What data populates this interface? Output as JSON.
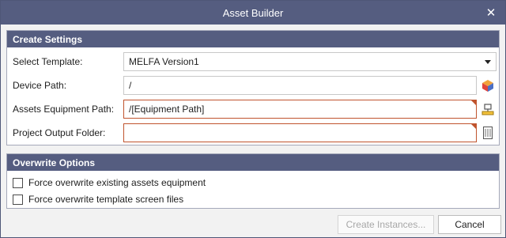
{
  "window": {
    "title": "Asset Builder",
    "close_glyph": "✕"
  },
  "create_settings": {
    "header": "Create Settings",
    "select_template": {
      "label": "Select Template:",
      "value": "MELFA Version1"
    },
    "device_path": {
      "label": "Device Path:",
      "value": "/",
      "icon": "device-picker-icon"
    },
    "assets_equipment_path": {
      "label": "Assets Equipment Path:",
      "value": "/[Equipment Path]",
      "icon": "equipment-picker-icon"
    },
    "project_output_folder": {
      "label": "Project Output Folder:",
      "value": "",
      "icon": "folder-browse-icon"
    }
  },
  "overwrite_options": {
    "header": "Overwrite Options",
    "force_assets": {
      "label": "Force overwrite existing assets equipment",
      "checked": false
    },
    "force_template": {
      "label": "Force overwrite template screen files",
      "checked": false
    }
  },
  "footer": {
    "create_label": "Create Instances...",
    "cancel_label": "Cancel"
  },
  "colors": {
    "header_bg": "#555d80",
    "required_border": "#c0542e"
  }
}
